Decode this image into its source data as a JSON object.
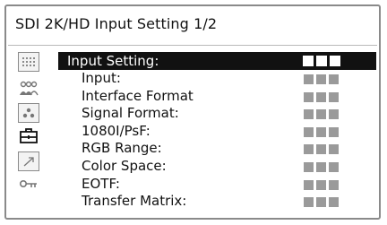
{
  "window": {
    "title": "SDI 2K/HD Input Setting 1/2"
  },
  "sidebar": {
    "icons": [
      "grid-icon",
      "people-icon",
      "dots-icon",
      "toolbox-icon",
      "arrow-icon",
      "key-icon"
    ]
  },
  "menu": {
    "header": {
      "label": "Input Setting:",
      "value_placeholder": "■■■"
    },
    "items": [
      {
        "label": "Input:"
      },
      {
        "label": "Interface Format"
      },
      {
        "label": "Signal Format:"
      },
      {
        "label": "1080I/PsF:"
      },
      {
        "label": "RGB Range:"
      },
      {
        "label": "Color Space:"
      },
      {
        "label": "EOTF:"
      },
      {
        "label": "Transfer Matrix:"
      }
    ]
  },
  "colors": {
    "highlight": "#111111",
    "placeholder": "#9a9a9a",
    "frame": "#8a8a8a"
  }
}
